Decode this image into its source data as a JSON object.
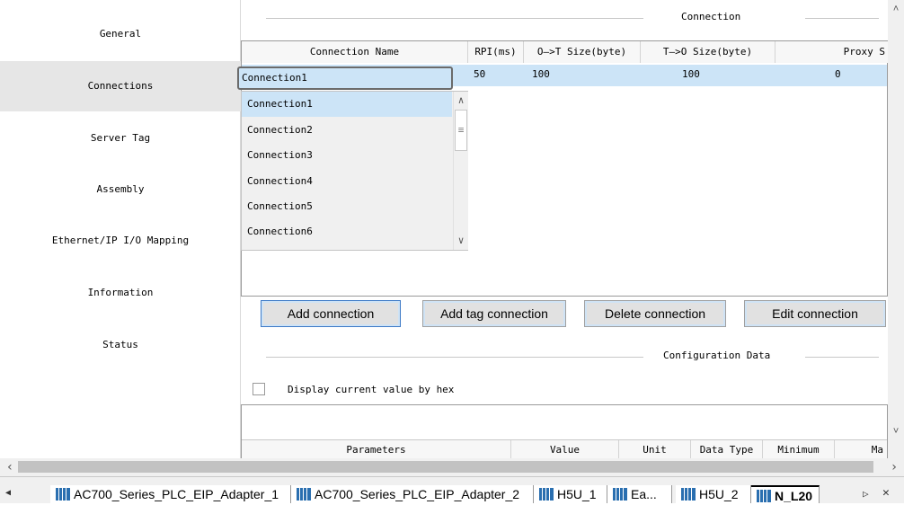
{
  "sidebar": {
    "items": [
      {
        "label": "General",
        "active": false
      },
      {
        "label": "Connections",
        "active": true
      },
      {
        "label": "Server Tag",
        "active": false
      },
      {
        "label": "Assembly",
        "active": false
      },
      {
        "label": "Ethernet/IP I/O Mapping",
        "active": false
      },
      {
        "label": "Information",
        "active": false
      },
      {
        "label": "Status",
        "active": false
      }
    ]
  },
  "connection_section": {
    "title": "Connection",
    "columns": [
      "Connection Name",
      "RPI(ms)",
      "O—>T Size(byte)",
      "T—>O Size(byte)",
      "Proxy S"
    ],
    "row": {
      "name": "Connection1",
      "rpi": "50",
      "ot_size": "100",
      "to_size": "100",
      "proxy": "0"
    },
    "dropdown_options": [
      "Connection1",
      "Connection2",
      "Connection3",
      "Connection4",
      "Connection5",
      "Connection6"
    ],
    "dropdown_selected": "Connection1"
  },
  "buttons": {
    "add_connection": "Add connection",
    "add_tag_connection": "Add tag connection",
    "delete_connection": "Delete connection",
    "edit_connection": "Edit connection"
  },
  "config_section": {
    "title": "Configuration Data",
    "hex_checkbox_label": "Display current value by hex",
    "hex_checked": false,
    "columns": [
      "Parameters",
      "Value",
      "Unit",
      "Data Type",
      "Minimum",
      "Ma"
    ]
  },
  "tabs": [
    {
      "label": "AC700_Series_PLC_EIP_Adapter_1",
      "active": false
    },
    {
      "label": "AC700_Series_PLC_EIP_Adapter_2",
      "active": false
    },
    {
      "label": "H5U_1",
      "active": false
    },
    {
      "label": "Ea...",
      "active": false
    },
    {
      "label": "H5U_2",
      "active": false
    },
    {
      "label": "N_L20",
      "active": true
    }
  ],
  "icons": {
    "scroll_up": "˄",
    "scroll_down": "˅",
    "scroll_left": "‹",
    "scroll_right": "›",
    "tabs_left": "◀",
    "tabs_right": "▷",
    "close": "✕",
    "dd_up": "∧",
    "dd_down": "∨",
    "dd_grip": "≡"
  },
  "colors": {
    "selection": "#cce4f7",
    "sidebar_active": "#e6e6e6",
    "button_focus": "#3d7ac6",
    "tab_icon": "#2a6fb0"
  }
}
